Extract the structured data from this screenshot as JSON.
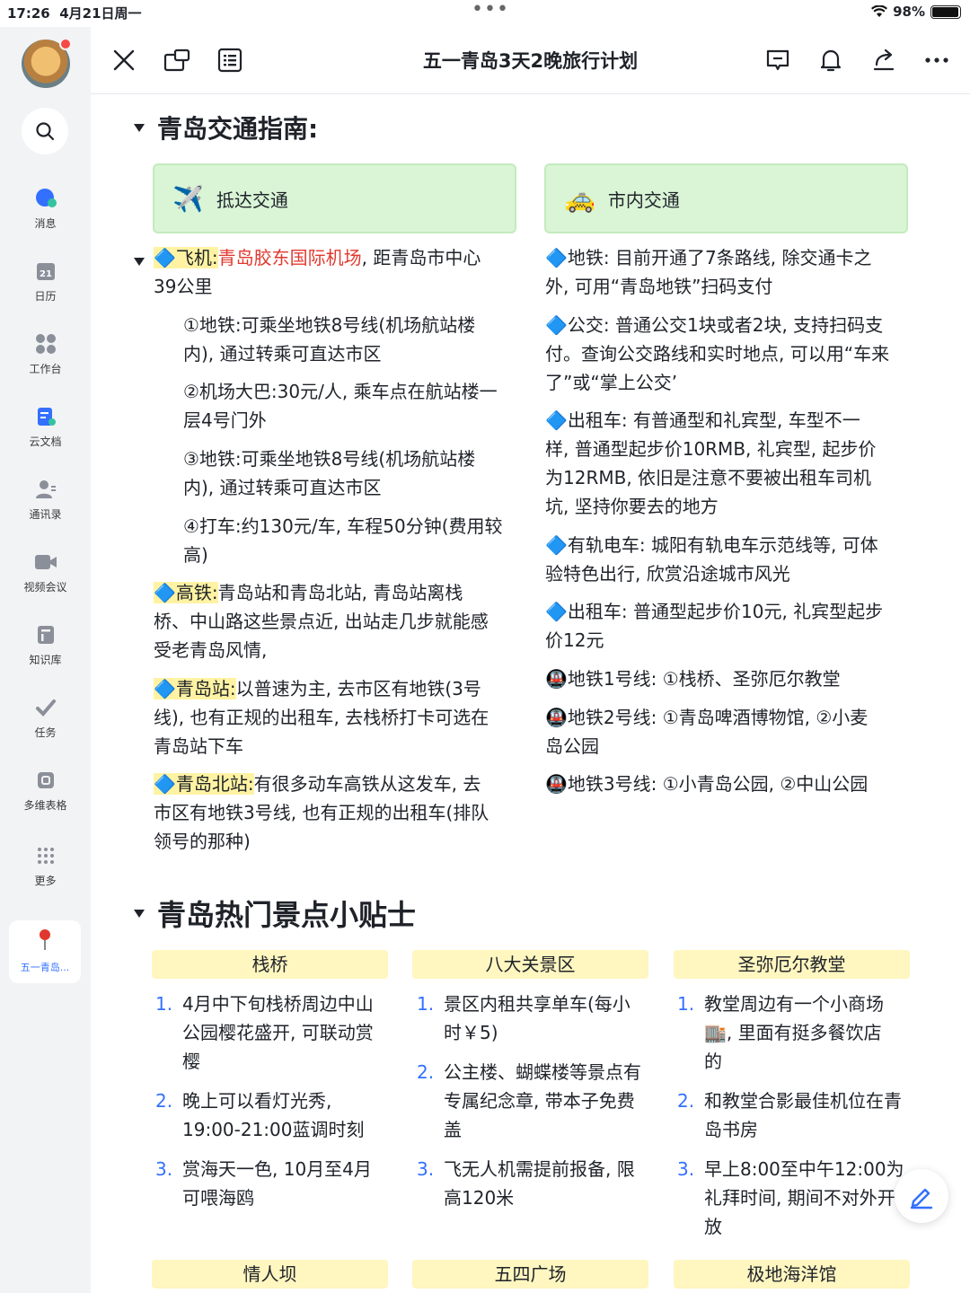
{
  "status": {
    "time": "17:26",
    "date": "4月21日周一",
    "battery": "98%",
    "battery_level": 0.98
  },
  "sidebar": {
    "items": [
      {
        "label": "消息",
        "icon": "message-icon"
      },
      {
        "label": "日历",
        "icon": "calendar-icon",
        "badge": "21"
      },
      {
        "label": "工作台",
        "icon": "workbench-icon"
      },
      {
        "label": "云文档",
        "icon": "cloud-doc-icon"
      },
      {
        "label": "通讯录",
        "icon": "contacts-icon"
      },
      {
        "label": "视频会议",
        "icon": "video-icon"
      },
      {
        "label": "知识库",
        "icon": "wiki-icon"
      },
      {
        "label": "任务",
        "icon": "task-icon"
      },
      {
        "label": "多维表格",
        "icon": "base-icon"
      },
      {
        "label": "更多",
        "icon": "more-icon"
      }
    ],
    "active_doc": "五一青岛..."
  },
  "header": {
    "title": "五一青岛3天2晚旅行计划"
  },
  "transport": {
    "heading": "青岛交通指南:",
    "arrive": {
      "label": "抵达交通",
      "plane_key": "飞机:",
      "plane_red": "青岛胶东国际机场",
      "plane_rest_1": ", 距青岛市中心",
      "plane_rest_2": "39公里",
      "opt1a": "①地铁:可乘坐地铁8号线(机场航站楼",
      "opt1b": "内), 通过转乘可直达市区",
      "opt2a": "②机场大巴:30元/人, 乘车点在航站楼一",
      "opt2b": "层4号门外",
      "opt3a": "③地铁:可乘坐地铁8号线(机场航站楼",
      "opt3b": "内), 通过转乘可直达市区",
      "opt4a": "④打车:约130元/车, 车程50分钟(费用较",
      "opt4b": "高)",
      "hsr_key": "高铁:",
      "hsr_1": "青岛站和青岛北站, 青岛站离栈",
      "hsr_2": "桥、中山路这些景点近, 出站走几步就能感",
      "hsr_3": "受老青岛风情,",
      "qd_key": "青岛站:",
      "qd_1": "以普速为主, 去市区有地铁(3号",
      "qd_2": "线), 也有正规的出租车, 去栈桥打卡可选在",
      "qd_3": "青岛站下车",
      "qdn_key": "青岛北站:",
      "qdn_1": "有很多动车高铁从这发车, 去",
      "qdn_2": "市区有地铁3号线, 也有正规的出租车(排队",
      "qdn_3": "领号的那种)"
    },
    "city": {
      "label": "市内交通",
      "metro_1": "地铁: 目前开通了7条路线, 除交通卡之",
      "metro_2": "外, 可用“青岛地铁”扫码支付",
      "bus_1": "公交: 普通公交1块或者2块, 支持扫码支",
      "bus_2": "付。查询公交路线和实时地点, 可以用“车来",
      "bus_3": "了”或“掌上公交’",
      "taxi_1": "出租车: 有普通型和礼宾型, 车型不一",
      "taxi_2": "样, 普通型起步价10RMB, 礼宾型, 起步价",
      "taxi_3": "为12RMB, 依旧是注意不要被出租车司机",
      "taxi_4": "坑, 坚持你要去的地方",
      "tram_1": "有轨电车: 城阳有轨电车示范线等, 可体",
      "tram_2": "验特色出行, 欣赏沿途城市风光",
      "taxi2_1": "出租车: 普通型起步价10元, 礼宾型起步",
      "taxi2_2": "价12元",
      "line1": "地铁1号线: ①栈桥、圣弥厄尔教堂",
      "line2_1": "地铁2号线: ①青岛啤酒博物馆, ②小麦",
      "line2_2": "岛公园",
      "line3": "地铁3号线: ①小青岛公园, ②中山公园"
    }
  },
  "tips": {
    "heading": "青岛热门景点小贴士",
    "columns": [
      {
        "name": "栈桥",
        "items": [
          [
            "4月中下旬栈桥周边中山",
            "公园樱花盛开, 可联动赏",
            "樱"
          ],
          [
            "晚上可以看灯光秀,",
            "19:00-21:00蓝调时刻"
          ],
          [
            "赏海天一色, 10月至4月",
            "可喂海鸥"
          ]
        ]
      },
      {
        "name": "八大关景区",
        "items": [
          [
            "景区内租共享单车(每小",
            "时￥5)"
          ],
          [
            "公主楼、蝴蝶楼等景点有",
            "专属纪念章, 带本子免费",
            "盖"
          ],
          [
            "飞无人机需提前报备, 限",
            "高120米"
          ]
        ]
      },
      {
        "name": "圣弥厄尔教堂",
        "items": [
          [
            "教堂周边有一个小商场",
            "🏬, 里面有挺多餐饮店",
            "的"
          ],
          [
            "和教堂合影最佳机位在青",
            "岛书房"
          ],
          [
            "早上8:00至中午12:00为",
            "礼拜时间, 期间不对外开",
            "放"
          ]
        ]
      }
    ],
    "next_row": [
      "情人坝",
      "五四广场",
      "极地海洋馆"
    ]
  },
  "colors": {
    "accent": "#3370ff",
    "callout": "#d9f5d6",
    "highlight": "#fff3a3",
    "red": "#e0382e"
  }
}
